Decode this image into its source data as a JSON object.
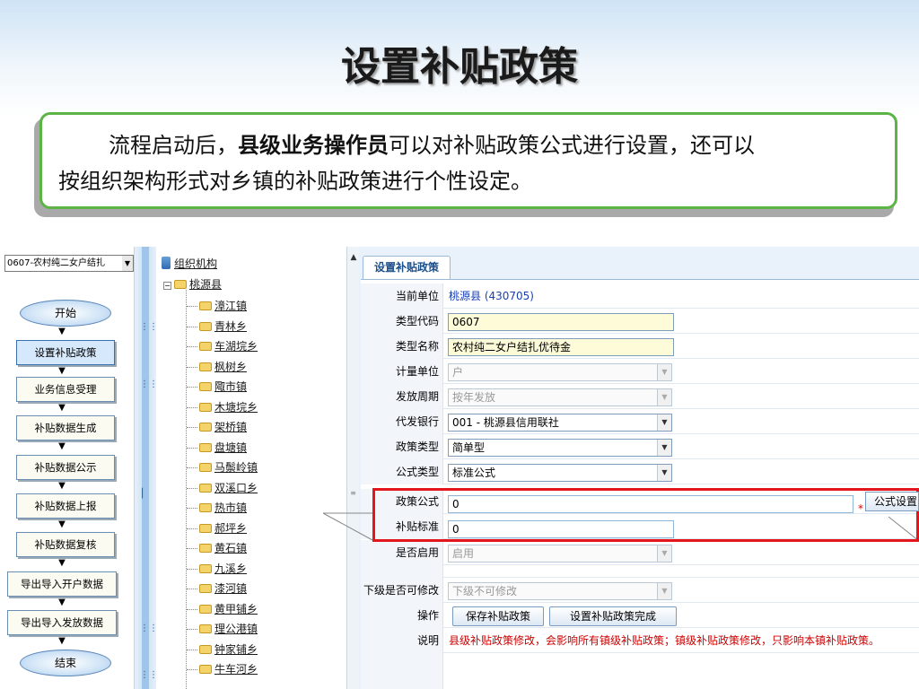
{
  "slide": {
    "title": "设置补贴政策",
    "intro_part1": "流程启动后，",
    "intro_bold": "县级业务操作员",
    "intro_part2": "可以对补贴政策公式进行设置，还可以",
    "intro_line2": "按组织架构形式对乡镇的补贴政策进行个性设定。"
  },
  "left_panel": {
    "type_select": "0607-农村纯二女户结扎",
    "start": "开始",
    "steps": [
      "设置补贴政策",
      "业务信息受理",
      "补贴数据生成",
      "补贴数据公示",
      "补贴数据上报",
      "补贴数据复核",
      "导出导入开户数据",
      "导出导入发放数据"
    ],
    "end": "结束"
  },
  "tree": {
    "root": "组织机构",
    "county": "桃源县",
    "towns": [
      "漳江镇",
      "青林乡",
      "车湖垸乡",
      "枫树乡",
      "陬市镇",
      "木塘垸乡",
      "架桥镇",
      "盘塘镇",
      "马鬃岭镇",
      "双溪口乡",
      "热市镇",
      "郝坪乡",
      "黄石镇",
      "九溪乡",
      "漆河镇",
      "黄甲铺乡",
      "理公港镇",
      "钟家铺乡",
      "牛车河乡"
    ]
  },
  "form": {
    "tab": "设置补贴政策",
    "rows": {
      "unit": {
        "label": "当前单位",
        "value": "桃源县 (430705)"
      },
      "type_code": {
        "label": "类型代码",
        "value": "0607"
      },
      "type_name": {
        "label": "类型名称",
        "value": "农村纯二女户结扎优待金"
      },
      "measure_unit": {
        "label": "计量单位",
        "value": "户"
      },
      "cycle": {
        "label": "发放周期",
        "value": "按年发放"
      },
      "bank": {
        "label": "代发银行",
        "value": "001 - 桃源县信用联社"
      },
      "policy_type": {
        "label": "政策类型",
        "value": "简单型"
      },
      "formula_type": {
        "label": "公式类型",
        "value": "标准公式"
      },
      "policy_formula": {
        "label": "政策公式",
        "value": "0"
      },
      "subsidy_standard": {
        "label": "补贴标准",
        "value": "0"
      },
      "enabled": {
        "label": "是否启用",
        "value": "启用"
      },
      "sub_modify": {
        "label": "下级是否可修改",
        "value": "下级不可修改"
      },
      "action": {
        "label": "操作",
        "save": "保存补贴政策",
        "complete": "设置补贴政策完成"
      },
      "note": {
        "label": "说明",
        "value": "县级补贴政策修改，会影响所有镇级补贴政策；镇级补贴政策修改，只影响本镇补贴政策。"
      }
    },
    "formula_button": "公式设置",
    "required_mark": "*"
  },
  "colors": {
    "highlight": "#e2161c",
    "intro_border": "#5cb446",
    "note": "#cc0000"
  }
}
